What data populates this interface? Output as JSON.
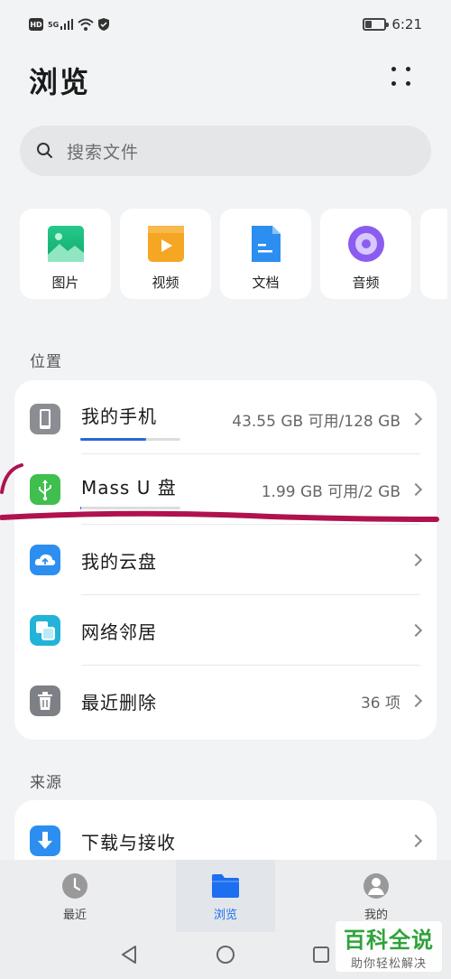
{
  "status_bar": {
    "hd": "HD",
    "signal": "5G",
    "time": "6:21"
  },
  "header": {
    "title": "浏览"
  },
  "search": {
    "placeholder": "搜索文件"
  },
  "categories": [
    {
      "label": "图片",
      "icon": "image-icon"
    },
    {
      "label": "视频",
      "icon": "video-icon"
    },
    {
      "label": "文档",
      "icon": "document-icon"
    },
    {
      "label": "音频",
      "icon": "audio-icon"
    }
  ],
  "locations": {
    "section_label": "位置",
    "items": [
      {
        "label": "我的手机",
        "value": "43.55 GB 可用/128 GB",
        "icon": "phone-icon",
        "usage_fraction": 0.66
      },
      {
        "label": "Mass U 盘",
        "value": "1.99 GB 可用/2 GB",
        "icon": "usb-icon",
        "usage_fraction": 0.005
      },
      {
        "label": "我的云盘",
        "value": "",
        "icon": "cloud-icon"
      },
      {
        "label": "网络邻居",
        "value": "",
        "icon": "network-icon"
      },
      {
        "label": "最近删除",
        "value": "36 项",
        "icon": "trash-icon"
      }
    ]
  },
  "sources": {
    "section_label": "来源",
    "items": [
      {
        "label": "下载与接收",
        "icon": "download-icon"
      }
    ]
  },
  "bottom_nav": [
    {
      "label": "最近",
      "icon": "clock-icon",
      "active": false
    },
    {
      "label": "浏览",
      "icon": "folder-icon",
      "active": true
    },
    {
      "label": "我的",
      "icon": "person-icon",
      "active": false
    }
  ],
  "watermark": {
    "title": "百科全说",
    "subtitle": "助你轻松解决"
  },
  "colors": {
    "accent": "#1e6ef0",
    "usage_bar": "#2b66d8",
    "annotation": "#b0124f"
  }
}
